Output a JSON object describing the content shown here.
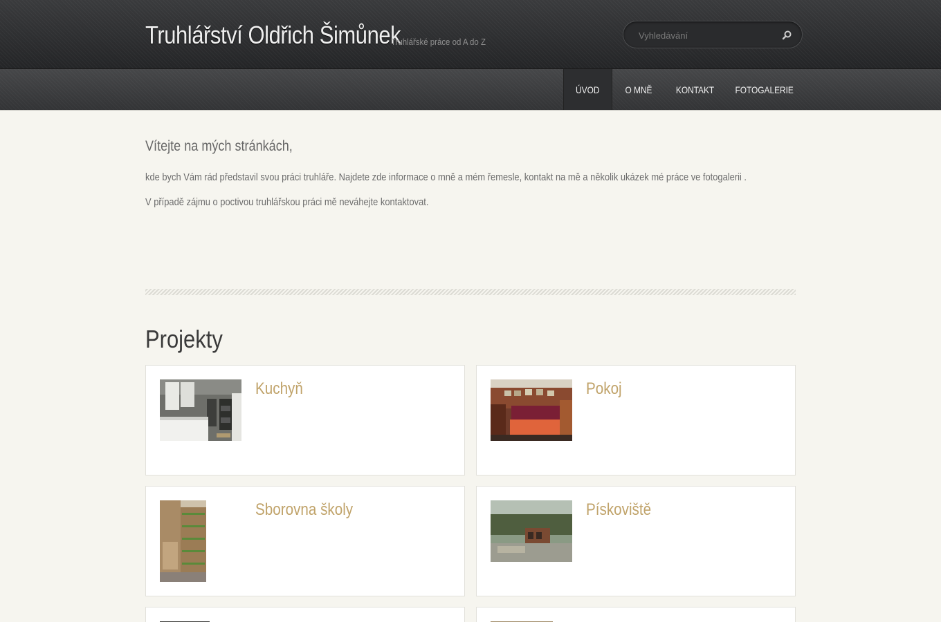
{
  "header": {
    "title": "Truhlářství Oldřich Šimůnek",
    "slogan": "Truhlářské práce od A do Z",
    "search_placeholder": "Vyhledávání",
    "search_icon": "search-icon"
  },
  "nav": {
    "items": [
      {
        "label": "ÚVOD",
        "active": true
      },
      {
        "label": "O MNĚ",
        "active": false
      },
      {
        "label": "KONTAKT",
        "active": false
      },
      {
        "label": "FOTOGALERIE",
        "active": false
      }
    ]
  },
  "intro": {
    "title": "Vítejte na mých stránkách,",
    "paragraph1": "kde bych Vám rád představil svou práci truhláře. Najdete zde informace o mně a mém řemesle, kontakt na mě a několik ukázek mé práce ve fotogalerii .",
    "paragraph2": "V případě zájmu o poctivou truhlářskou práci mě neváhejte kontaktovat."
  },
  "projects": {
    "heading": "Projekty",
    "items": [
      {
        "title": "Kuchyň"
      },
      {
        "title": "Pokoj"
      },
      {
        "title": "Sborovna školy"
      },
      {
        "title": "Pískoviště"
      }
    ]
  },
  "colors": {
    "accent": "#c0a36a",
    "background": "#f6f5ef",
    "header": "#2b2c2e"
  }
}
